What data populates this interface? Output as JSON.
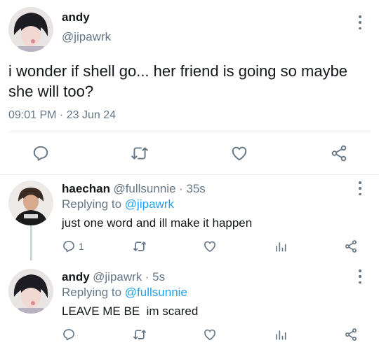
{
  "main_tweet": {
    "name": "andy",
    "handle": "@jipawrk",
    "text_line1": "i wonder if shell go... her friend is going so maybe",
    "text_line2": "she will too?",
    "timestamp": "09:01 PM · 23 Jun 24"
  },
  "replies": [
    {
      "name": "haechan",
      "handle": "@fullsunnie",
      "time": "· 35s",
      "replying_label": "Replying to",
      "replying_handle": "@jipawrk",
      "text": "just one word and ill make it happen",
      "reply_count": "1"
    },
    {
      "name": "andy",
      "handle": "@jipawrk",
      "time": "· 5s",
      "replying_label": "Replying to",
      "replying_handle": "@fullsunnie",
      "text": "LEAVE ME BE  im scared",
      "reply_count": ""
    }
  ],
  "colors": {
    "accent": "#1da1f2",
    "muted": "#657786",
    "icon": "#657786",
    "divider": "#e6ecf0"
  },
  "icons": [
    "reply-icon",
    "retweet-icon",
    "like-icon",
    "analytics-icon",
    "share-icon",
    "more-icon"
  ]
}
